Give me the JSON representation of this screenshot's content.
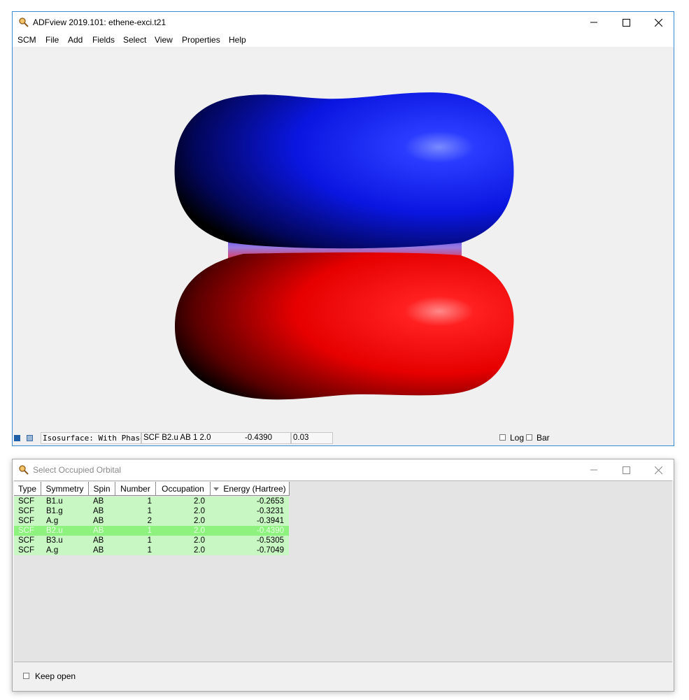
{
  "main_window": {
    "title": "ADFview 2019.101: ethene-exci.t21",
    "menu": [
      "SCM",
      "File",
      "Add",
      "Fields",
      "Select",
      "View",
      "Properties",
      "Help"
    ],
    "controls": [
      "minimize-icon",
      "maximize-icon",
      "close-icon"
    ],
    "viewport": {
      "description_icon": "orbital-isosurface",
      "colors": {
        "positive_lobe": "#0a16e0",
        "negative_lobe": "#e60000",
        "background": "#f0f0f0"
      }
    },
    "status": {
      "field1": "Isosurface: With Phase",
      "field2": "SCF B2.u AB 1 2.0",
      "field2_energy": "-0.4390",
      "field3": "0.03",
      "log_label": "Log",
      "bar_label": "Bar"
    }
  },
  "dialog": {
    "title": "Select Occupied Orbital",
    "columns": [
      "Type",
      "Symmetry",
      "Spin",
      "Number",
      "Occupation",
      "Energy (Hartree)"
    ],
    "sort_column": "Energy (Hartree)",
    "rows": [
      {
        "type": "SCF",
        "symmetry": "B1.u",
        "spin": "AB",
        "number": "1",
        "occupation": "2.0",
        "energy": "-0.2653",
        "selected": false
      },
      {
        "type": "SCF",
        "symmetry": "B1.g",
        "spin": "AB",
        "number": "1",
        "occupation": "2.0",
        "energy": "-0.3231",
        "selected": false
      },
      {
        "type": "SCF",
        "symmetry": "A.g",
        "spin": "AB",
        "number": "2",
        "occupation": "2.0",
        "energy": "-0.3941",
        "selected": false
      },
      {
        "type": "SCF",
        "symmetry": "B2.u",
        "spin": "AB",
        "number": "1",
        "occupation": "2.0",
        "energy": "-0.4390",
        "selected": true
      },
      {
        "type": "SCF",
        "symmetry": "B3.u",
        "spin": "AB",
        "number": "1",
        "occupation": "2.0",
        "energy": "-0.5305",
        "selected": false
      },
      {
        "type": "SCF",
        "symmetry": "A.g",
        "spin": "AB",
        "number": "1",
        "occupation": "2.0",
        "energy": "-0.7049",
        "selected": false
      }
    ],
    "colors": {
      "row_bg": "#c9f7c4",
      "selected_bg": "#8ef27f"
    },
    "keep_open_label": "Keep open"
  }
}
